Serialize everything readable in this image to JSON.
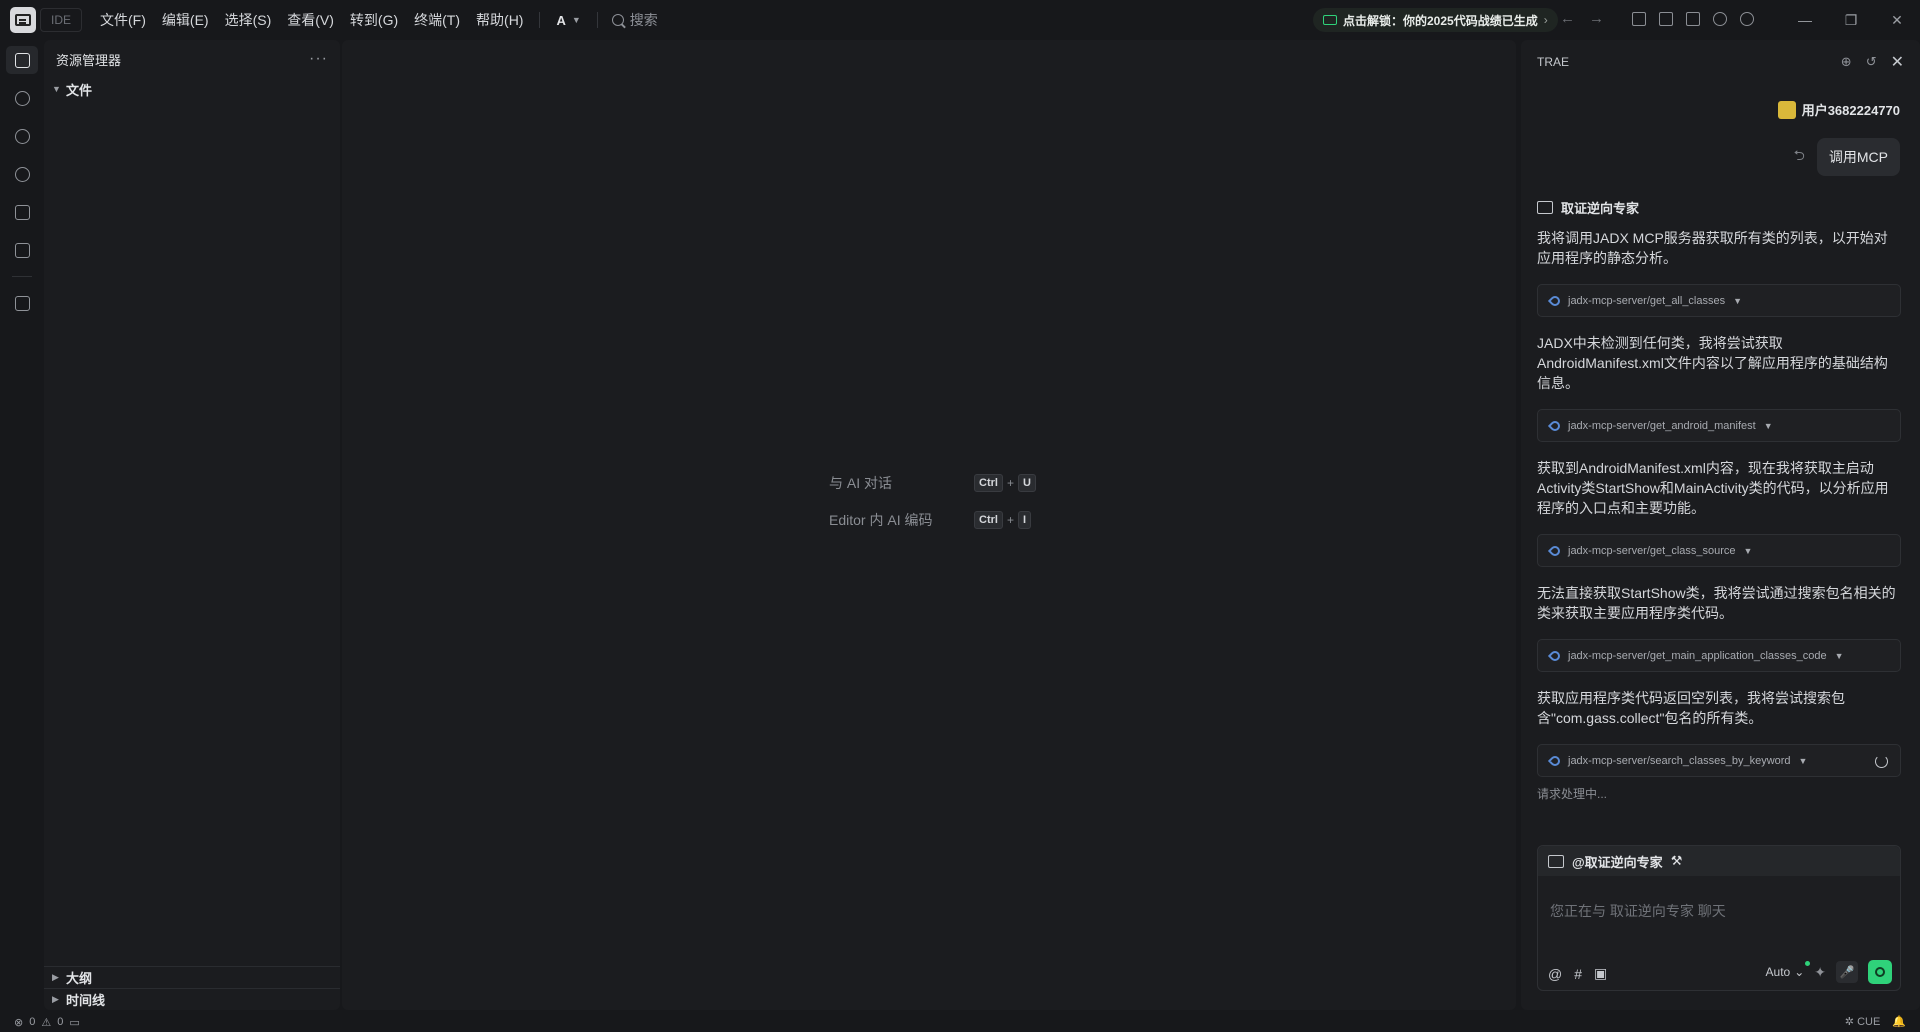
{
  "titlebar": {
    "ide_label": "IDE",
    "menus": [
      "文件(F)",
      "编辑(E)",
      "选择(S)",
      "查看(V)",
      "转到(G)",
      "终端(T)",
      "帮助(H)"
    ],
    "model_label": "A",
    "search_placeholder": "搜索",
    "promo": "点击解锁：你的2025代码战绩已生成",
    "promo_color": "#2fd27a"
  },
  "explorer": {
    "title": "资源管理器",
    "root": "文件",
    "outline": "大纲",
    "timeline": "时间线"
  },
  "editor": {
    "hints": [
      {
        "label": "与 AI 对话",
        "mod": "Ctrl",
        "key": "U"
      },
      {
        "label": "Editor 内 AI 编码",
        "mod": "Ctrl",
        "key": "I"
      }
    ]
  },
  "trae": {
    "title": "TRAE",
    "user_name": "用户3682224770",
    "user_message": "调用MCP",
    "agent_name": "取证逆向专家",
    "messages": [
      "我将调用JADX MCP服务器获取所有类的列表，以开始对应用程序的静态分析。",
      "JADX中未检测到任何类，我将尝试获取AndroidManifest.xml文件内容以了解应用程序的基础结构信息。",
      "获取到AndroidManifest.xml内容，现在我将获取主启动Activity类StartShow和MainActivity类的代码，以分析应用程序的入口点和主要功能。",
      "无法直接获取StartShow类，我将尝试通过搜索包名相关的类来获取主要应用程序类代码。",
      "获取应用程序类代码返回空列表，我将尝试搜索包含\"com.gass.collect\"包名的所有类。"
    ],
    "tools": [
      "jadx-mcp-server/get_all_classes",
      "jadx-mcp-server/get_android_manifest",
      "jadx-mcp-server/get_class_source",
      "jadx-mcp-server/get_main_application_classes_code",
      "jadx-mcp-server/search_classes_by_keyword"
    ],
    "pending": "请求处理中...",
    "composer_agent": "@取证逆向专家",
    "composer_placeholder": "您正在与 取证逆向专家 聊天",
    "mode": "Auto",
    "accent": "#2fd27a"
  },
  "status": {
    "errors": "0",
    "warnings": "0",
    "right_label": "CUE"
  }
}
